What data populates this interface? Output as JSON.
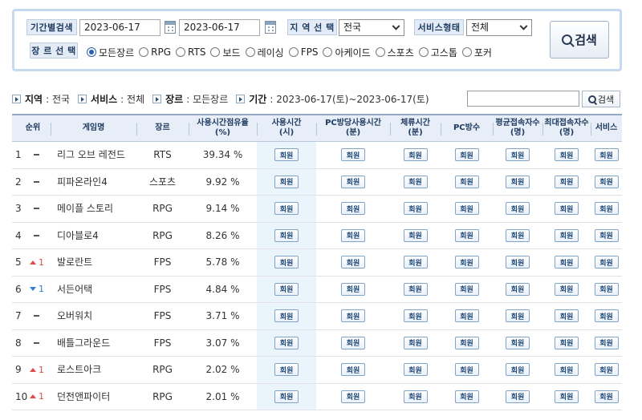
{
  "search": {
    "period_label": "기간별검색",
    "start_date": "2023-06-17",
    "end_date": "2023-06-17",
    "region_label": "지 역 선 택",
    "region_value": "전국",
    "service_label": "서비스형태",
    "service_value": "전체",
    "genre_label": "장 르 선 택",
    "genres": [
      "모든장르",
      "RPG",
      "RTS",
      "보드",
      "레이싱",
      "FPS",
      "아케이드",
      "스포츠",
      "고스톱",
      "포커"
    ],
    "selected_genre": "모든장르",
    "button_label": "검색"
  },
  "summary": {
    "region_key": "지역",
    "region_val": ": 전국",
    "service_key": "서비스",
    "service_val": ": 전체",
    "genre_key": "장르",
    "genre_val": ": 모든장르",
    "period_key": "기간",
    "period_val": ": 2023-06-17(토)~2023-06-17(토)",
    "search_button": "검색",
    "search_input_value": ""
  },
  "table": {
    "headers": {
      "rank": "순위",
      "name": "게임명",
      "genre": "장르",
      "share": "사용시간점유율\n(%)",
      "use_time": "사용시간\n(시)",
      "pc_time": "PC방당사용시간\n(분)",
      "stay_time": "체류시간\n(분)",
      "pc_count": "PC방수",
      "avg_users": "평균접속자수\n(명)",
      "max_users": "최대접속자수\n(명)",
      "service": "서비스"
    },
    "member_label": "회원",
    "rows": [
      {
        "rank": "1",
        "change": "same",
        "change_val": "",
        "name": "리그 오브 레전드",
        "genre": "RTS",
        "share": "39.34 %"
      },
      {
        "rank": "2",
        "change": "same",
        "change_val": "",
        "name": "피파온라인4",
        "genre": "스포츠",
        "share": "9.92 %"
      },
      {
        "rank": "3",
        "change": "same",
        "change_val": "",
        "name": "메이플 스토리",
        "genre": "RPG",
        "share": "9.14 %"
      },
      {
        "rank": "4",
        "change": "same",
        "change_val": "",
        "name": "디아블로4",
        "genre": "RPG",
        "share": "8.26 %"
      },
      {
        "rank": "5",
        "change": "up",
        "change_val": "1",
        "name": "발로란트",
        "genre": "FPS",
        "share": "5.78 %"
      },
      {
        "rank": "6",
        "change": "down",
        "change_val": "1",
        "name": "서든어택",
        "genre": "FPS",
        "share": "4.84 %"
      },
      {
        "rank": "7",
        "change": "same",
        "change_val": "",
        "name": "오버워치",
        "genre": "FPS",
        "share": "3.71 %"
      },
      {
        "rank": "8",
        "change": "same",
        "change_val": "",
        "name": "배틀그라운드",
        "genre": "FPS",
        "share": "3.07 %"
      },
      {
        "rank": "9",
        "change": "up",
        "change_val": "1",
        "name": "로스트아크",
        "genre": "RPG",
        "share": "2.02 %"
      },
      {
        "rank": "10",
        "change": "up",
        "change_val": "1",
        "name": "던전앤파이터",
        "genre": "RPG",
        "share": "2.01 %"
      }
    ]
  },
  "colors": {
    "panel_border": "#c5daf0",
    "header_bg": "#e7eef7",
    "highlight_col": "#eaf4fb",
    "rank_up": "#e14a4a",
    "rank_down": "#2e7fd6"
  }
}
